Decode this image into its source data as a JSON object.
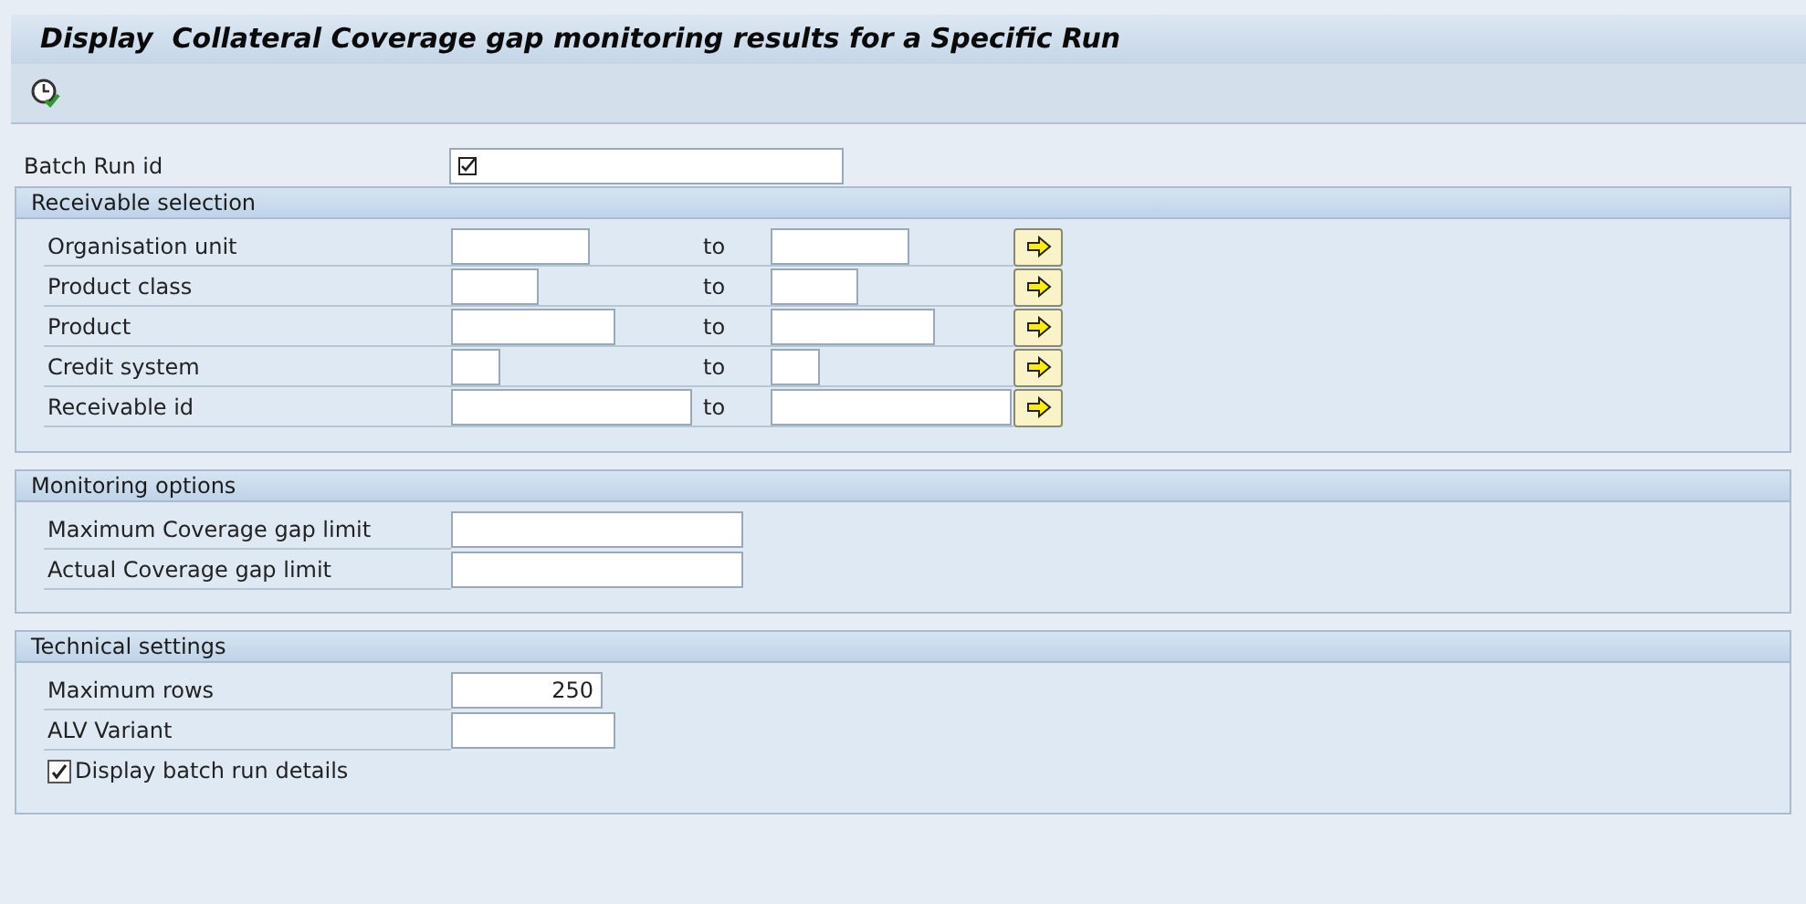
{
  "window": {
    "title": "Display  Collateral Coverage gap monitoring results for a Specific Run"
  },
  "batch_run": {
    "label": "Batch Run id"
  },
  "receivable_selection": {
    "title": "Receivable selection",
    "rows": [
      {
        "label": "Organisation unit",
        "to_label": "to"
      },
      {
        "label": "Product class",
        "to_label": "to"
      },
      {
        "label": "Product",
        "to_label": "to"
      },
      {
        "label": "Credit system",
        "to_label": "to"
      },
      {
        "label": "Receivable id",
        "to_label": "to"
      }
    ]
  },
  "monitoring_options": {
    "title": "Monitoring options",
    "fields": [
      {
        "label": "Maximum Coverage gap limit"
      },
      {
        "label": "Actual Coverage gap limit"
      }
    ]
  },
  "technical_settings": {
    "title": "Technical settings",
    "fields": [
      {
        "label": "Maximum rows",
        "value": "250",
        "kind": "number"
      },
      {
        "label": "ALV Variant",
        "kind": "text"
      }
    ],
    "checkbox": {
      "label": "Display batch run details",
      "checked": true
    }
  }
}
